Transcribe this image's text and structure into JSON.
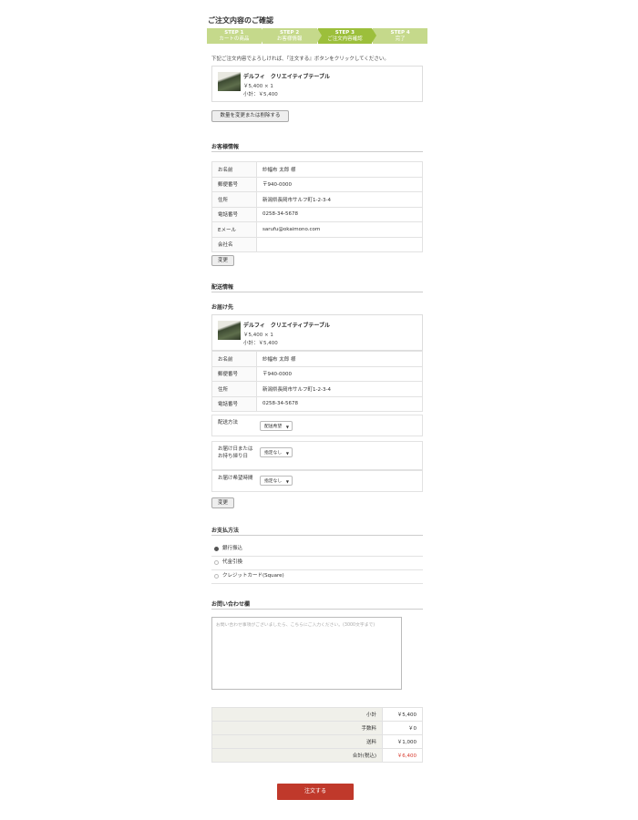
{
  "page_title": "ご注文内容のご確認",
  "steps": [
    {
      "num": "STEP 1",
      "label": "カートの商品"
    },
    {
      "num": "STEP 2",
      "label": "お客様情報"
    },
    {
      "num": "STEP 3",
      "label": "ご注文内容確認"
    },
    {
      "num": "STEP 4",
      "label": "完了"
    }
  ],
  "notice": "下記ご注文内容でよろしければ、『注文する』ボタンをクリックしてください。",
  "cart_item": {
    "name": "デルフィ　クリエイティブテーブル",
    "price": "￥5,400 × 1",
    "subtotal": "小計：￥5,400"
  },
  "change_qty_button": "数量を変更または削除する",
  "customer": {
    "heading": "お客様情報",
    "rows": [
      {
        "k": "お名前",
        "v": "紗幅布 太郎 様"
      },
      {
        "k": "郵便番号",
        "v": "〒940-0000"
      },
      {
        "k": "住所",
        "v": "新潟県長岡市サルフ町1-2-3-4"
      },
      {
        "k": "電話番号",
        "v": "0258-34-5678"
      },
      {
        "k": "Eメール",
        "v": "sarufu@okaimono.com"
      },
      {
        "k": "会社名",
        "v": ""
      }
    ],
    "change_button": "変更"
  },
  "shipping": {
    "heading": "配送情報",
    "sub_heading": "お届け先",
    "item": {
      "name": "デルフィ　クリエイティブテーブル",
      "price": "￥5,400 × 1",
      "subtotal": "小計：￥5,400"
    },
    "rows": [
      {
        "k": "お名前",
        "v": "紗幅布 太郎 様"
      },
      {
        "k": "郵便番号",
        "v": "〒940-0000"
      },
      {
        "k": "住所",
        "v": "新潟県長岡市サルフ町1-2-3-4"
      },
      {
        "k": "電話番号",
        "v": "0258-34-5678"
      }
    ],
    "method_label": "配送方法",
    "method_value": "配送希望",
    "date_label": "お届け日またはお持ち帰り日",
    "date_value": "指定なし",
    "time_label": "お届け希望時間",
    "time_value": "指定なし",
    "change_button": "変更"
  },
  "payment": {
    "heading": "お支払方法",
    "options": [
      {
        "label": "銀行振込",
        "selected": true
      },
      {
        "label": "代金引換",
        "selected": false
      },
      {
        "label": "クレジットカード(Square)",
        "selected": false
      }
    ]
  },
  "inquiry": {
    "heading": "お問い合わせ欄",
    "placeholder": "お問い合わせ事項がございましたら、こちらにご入力ください。(3000文字まで)"
  },
  "totals": [
    {
      "label": "小計",
      "value": "￥5,400"
    },
    {
      "label": "手数料",
      "value": "￥0"
    },
    {
      "label": "送料",
      "value": "￥1,000"
    },
    {
      "label": "合計(税込)",
      "value": "￥6,400"
    }
  ],
  "submit_button": "注文する",
  "colors": {
    "step": "#c5d98b",
    "step_active": "#9cbf3b",
    "submit": "#c0392b",
    "total": "#d83a2e"
  }
}
